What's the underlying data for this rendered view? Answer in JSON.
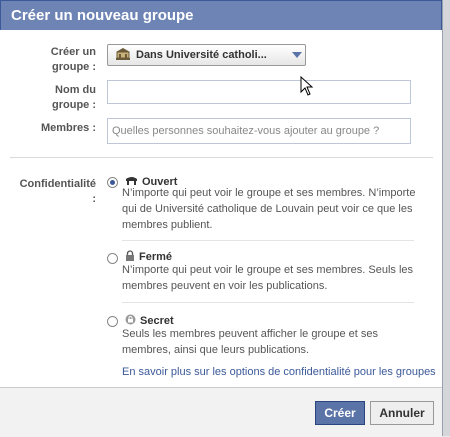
{
  "dialog": {
    "title": "Créer un nouveau groupe"
  },
  "form": {
    "create_label_1": "Créer un",
    "create_label_2": "groupe :",
    "create_value": "Dans Université catholi...",
    "name_label_1": "Nom du",
    "name_label_2": "groupe :",
    "name_value": "",
    "members_label": "Membres :",
    "members_placeholder": "Quelles personnes souhaitez-vous ajouter au groupe ?",
    "privacy_label_1": "Confidentialité",
    "privacy_label_2": ":"
  },
  "privacy": {
    "options": [
      {
        "title": "Ouvert",
        "desc_1": "N’importe qui peut voir le groupe et ses membres. N’importe",
        "desc_2": "qui de Université catholique de Louvain peut voir ce que les",
        "desc_3": "membres publient.",
        "selected": true
      },
      {
        "title": "Fermé",
        "desc_1": "N’importe qui peut voir le groupe et ses membres. Seuls les",
        "desc_2": "membres peuvent en voir les publications.",
        "selected": false
      },
      {
        "title": "Secret",
        "desc_1": "Seuls les membres peuvent afficher le groupe et ses",
        "desc_2": "membres, ainsi que leurs publications.",
        "selected": false
      }
    ],
    "learn_more": "En savoir plus sur les options de confidentialité pour les groupes"
  },
  "footer": {
    "create_button": "Créer",
    "cancel_button": "Annuler"
  },
  "colors": {
    "titlebar": "#6d84b4",
    "link": "#3b5998",
    "primary_button": "#5b74a8"
  },
  "icons": [
    "school-icon",
    "globe-icon",
    "lock-icon",
    "secret-lock-icon",
    "mouse-cursor-icon"
  ]
}
